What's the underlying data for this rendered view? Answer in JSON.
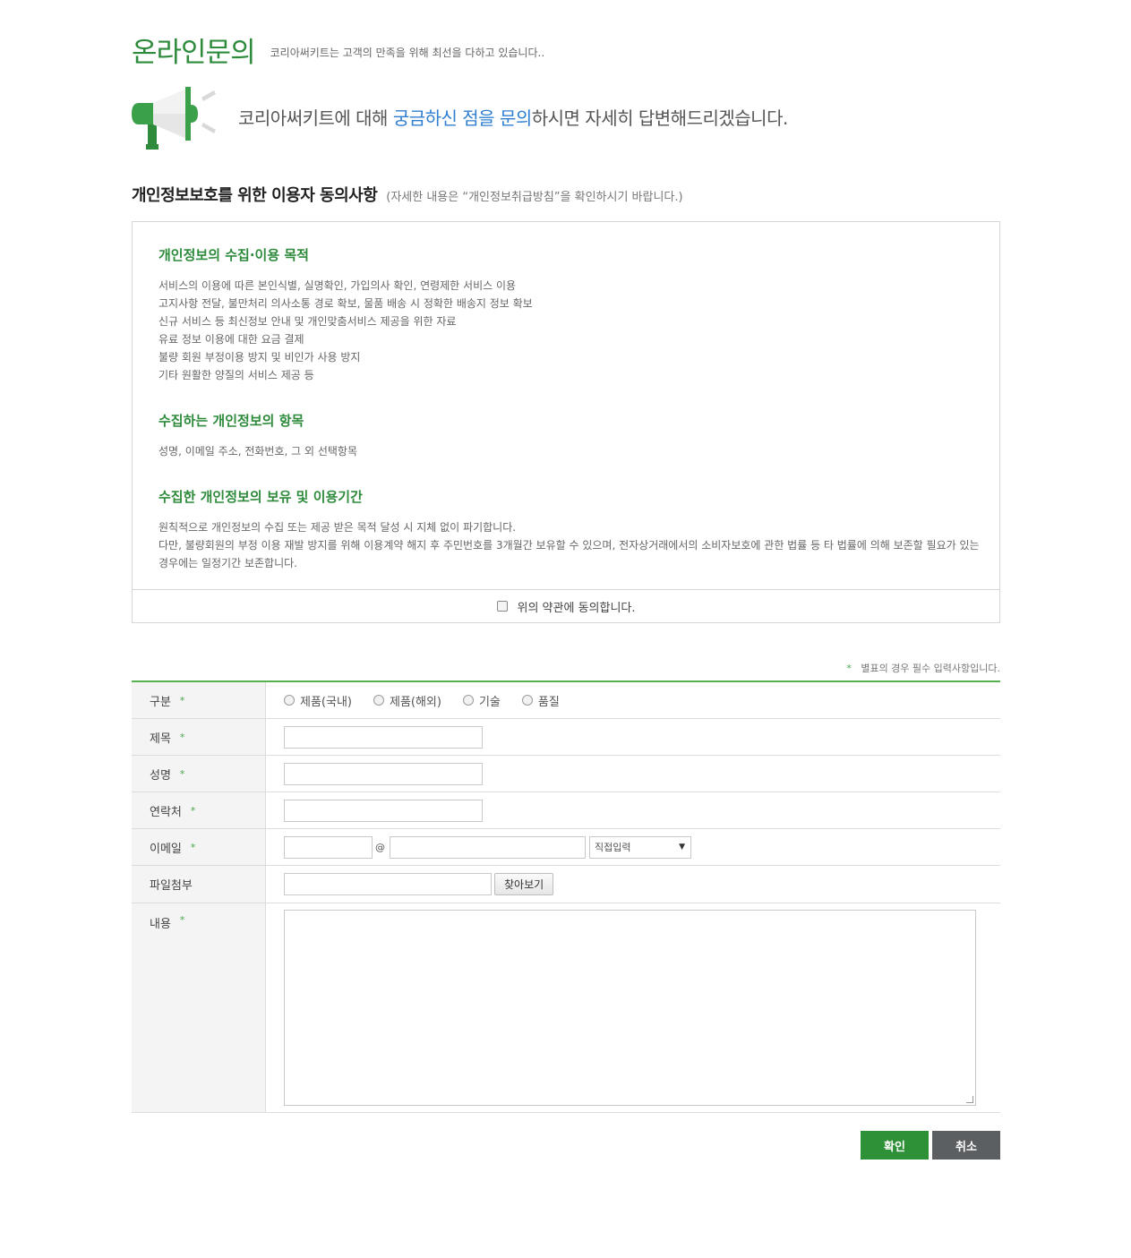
{
  "header": {
    "title": "온라인문의",
    "subtitle": "코리아써키트는 고객의 만족을 위해 최선을 다하고 있습니다.."
  },
  "hero": {
    "icon": "megaphone-icon",
    "text_before": "코리아써키트에 대해 ",
    "text_highlight": "궁금하신 점을 문의",
    "text_after": "하시면 자세히 답변해드리겠습니다."
  },
  "privacy": {
    "title": "개인정보보호를 위한 이용자 동의사항",
    "note": "(자세한 내용은 “개인정보취급방침”을 확인하시기 바랍니다.)",
    "sections": [
      {
        "heading": "개인정보의 수집·이용 목적",
        "lines": [
          "서비스의 이용에 따른 본인식별, 실명확인, 가입의사 확인, 연령제한 서비스 이용",
          "고지사항 전달, 불만처리 의사소통 경로 확보, 물품 배송 시 정확한 배송지 정보 확보",
          "신규 서비스 등 최신정보 안내 및 개인맞춤서비스 제공을 위한 자료",
          "유료 정보 이용에 대한 요금 결제",
          "불량 회원 부정이용 방지 및 비인가 사용 방지",
          "기타 원활한 양질의 서비스 제공 등"
        ]
      },
      {
        "heading": "수집하는 개인정보의 항목",
        "lines": [
          "성명, 이메일 주소, 전화번호, 그 외 선택항목"
        ]
      },
      {
        "heading": "수집한 개인정보의 보유 및 이용기간",
        "lines": [
          "원칙적으로 개인정보의 수집 또는 제공 받은 목적 달성 시 지체 없이 파기합니다.",
          "다만, 불량회원의 부정 이용 재발 방지를 위해 이용계약 해지 후 주민번호를 3개월간 보유할 수 있으며, 전자상거래에서의 소비자보호에 관한 법률 등 타 법률에 의해 보존할 필요가 있는 경우에는 일정기간 보존합니다."
        ]
      }
    ],
    "agree_label": "위의 약관에 동의합니다.",
    "agree_checked": false
  },
  "form": {
    "required_note_star": "*",
    "required_note": "별표의 경우 필수 입력사항입니다.",
    "required_star": "*",
    "category": {
      "label": "구분",
      "options": [
        "제품(국내)",
        "제품(해외)",
        "기술",
        "품질"
      ],
      "selected": null
    },
    "subject": {
      "label": "제목",
      "value": ""
    },
    "name": {
      "label": "성명",
      "value": ""
    },
    "phone": {
      "label": "연락처",
      "value": ""
    },
    "email": {
      "label": "이메일",
      "local": "",
      "at": "@",
      "domain": "",
      "domain_select": "직접입력"
    },
    "attachment": {
      "label": "파일첨부",
      "value": "",
      "browse_label": "찾아보기"
    },
    "content": {
      "label": "내용",
      "value": ""
    }
  },
  "actions": {
    "confirm": "확인",
    "cancel": "취소"
  },
  "colors": {
    "brand_green": "#2e8b3c",
    "highlight_blue": "#2f7fd1",
    "confirm_button": "#2f9137",
    "cancel_button": "#5b5f62"
  }
}
